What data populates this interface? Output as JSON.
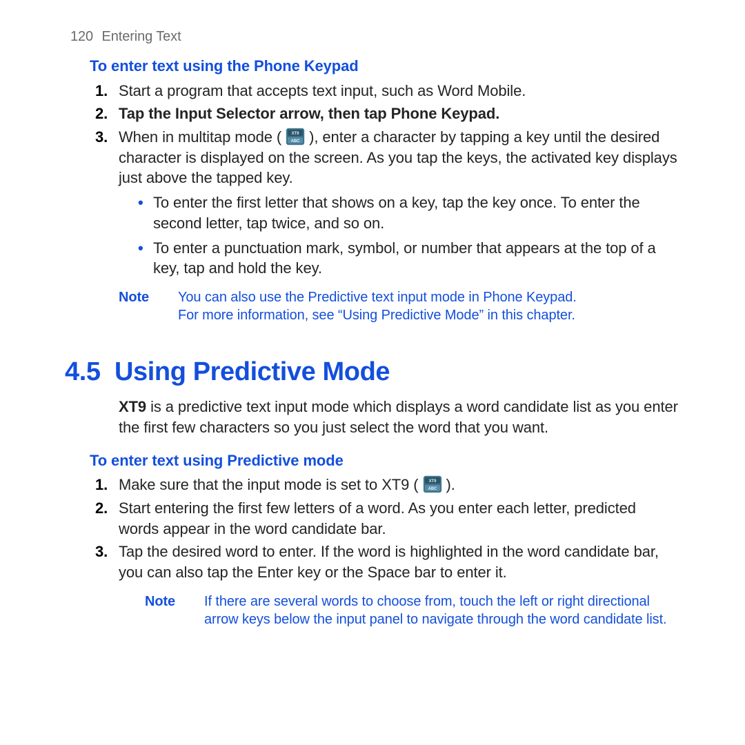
{
  "page": {
    "num": "120",
    "title": "Entering Text"
  },
  "s1": {
    "heading": "To enter text using the Phone Keypad",
    "i1": {
      "n": "1.",
      "text": "Start a program that accepts text input, such as Word Mobile."
    },
    "i2": {
      "n": "2.",
      "a": "Tap the ",
      "b": "Input Selector",
      "c": " arrow, then tap ",
      "d": "Phone Keypad",
      "e": "."
    },
    "i3": {
      "n": "3.",
      "a": "When in multitap mode ( ",
      "b": " ), enter a character by tapping a key until the desired character is displayed on the screen. As you tap the keys, the activated key displays just above the tapped key."
    },
    "b1": "To enter the first letter that shows on a key, tap the key once. To enter the second letter, tap twice, and so on.",
    "b2": "To enter a punctuation mark, symbol, or number that appears at the top of a key, tap and hold the key.",
    "note": {
      "label": "Note",
      "l1": "You can also use the Predictive text input mode in Phone Keypad.",
      "l2": "For more information, see “Using Predictive Mode” in this chapter."
    }
  },
  "s2": {
    "num": "4.5",
    "title": "Using Predictive Mode",
    "intro": {
      "a": "XT9",
      "b": " is a predictive text input mode which displays a word candidate list as you enter the first few characters so you just select the word that you want."
    },
    "sub": "To enter text using Predictive mode",
    "i1": {
      "n": "1.",
      "a": "Make sure that the input mode is set to XT9 ( ",
      "b": " )."
    },
    "i2": {
      "n": "2.",
      "text": "Start entering the first few letters of a word. As you enter each letter, predicted words appear in the word candidate bar."
    },
    "i3": {
      "n": "3.",
      "text": "Tap the desired word to enter. If the word is highlighted in the word candidate bar, you can also tap the Enter key or the Space bar to enter it."
    },
    "note": {
      "label": "Note",
      "text": "If there are several words to choose from, touch the left or right directional arrow keys below the input panel to navigate through the word candidate list."
    }
  },
  "icon": {
    "top": "XT9",
    "bot": "ABC"
  }
}
